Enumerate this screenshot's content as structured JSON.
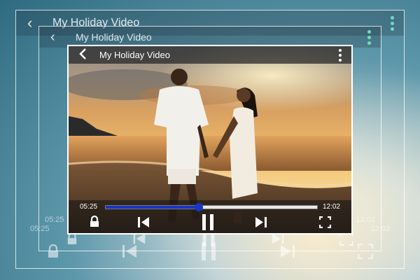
{
  "player": {
    "title": "My  Holiday Video",
    "current_time": "05:25",
    "duration": "12:02",
    "progress": 0.44
  },
  "ghost": {
    "title": "My  Holiday Video",
    "current_time": "05:25",
    "duration": "12:02"
  },
  "icons": {
    "back": "back-arrow-icon",
    "menu": "more-vertical-icon",
    "lock": "lock-icon",
    "previous": "skip-previous-icon",
    "pause": "pause-icon",
    "next": "skip-next-icon",
    "fullscreen": "fullscreen-icon"
  },
  "colors": {
    "progress": "#1a33c8",
    "accent_dots": "#78e6c8"
  }
}
